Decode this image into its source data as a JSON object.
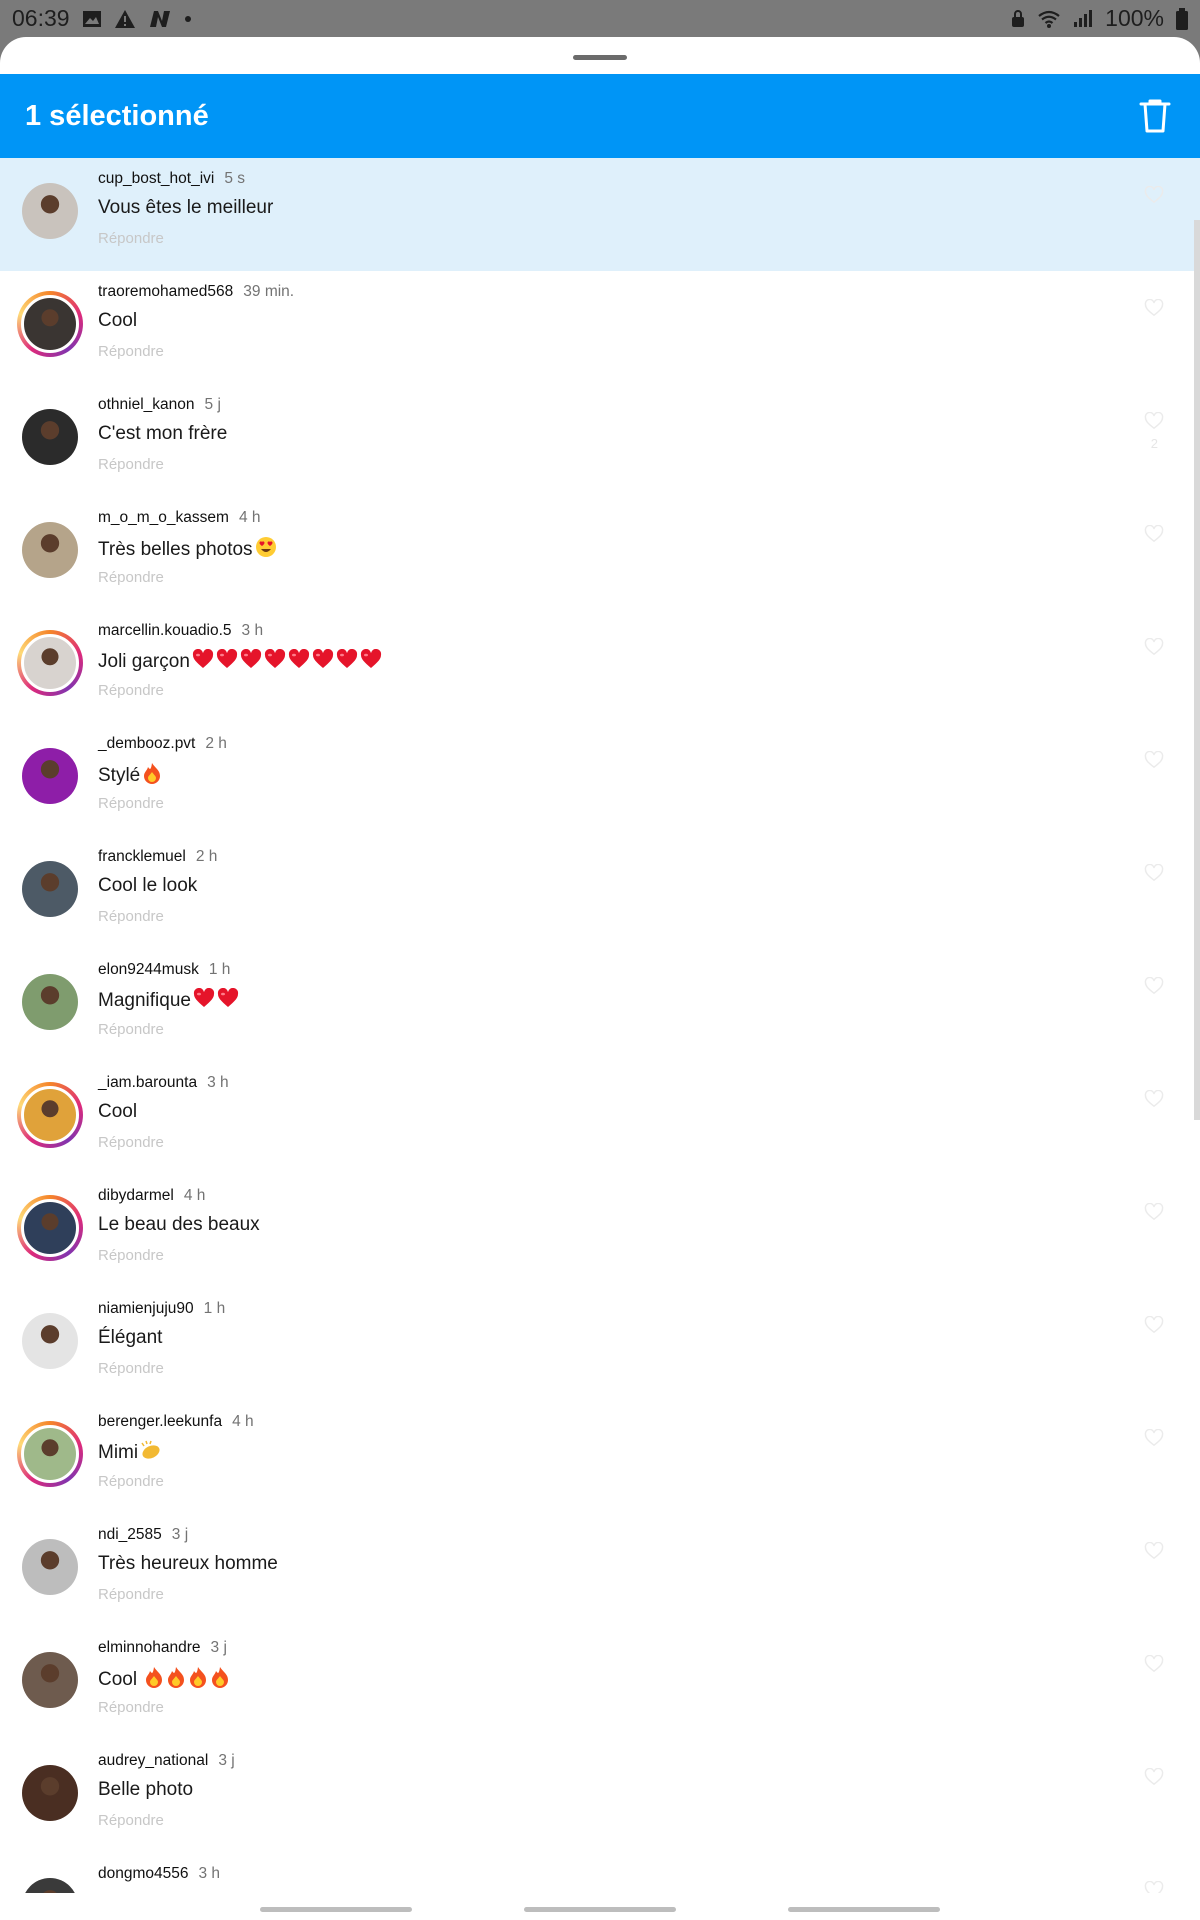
{
  "status_bar": {
    "time": "06:39",
    "battery": "100%",
    "left_icons": [
      "image-icon",
      "alert-icon",
      "n-icon",
      "dot-icon"
    ],
    "right_icons": [
      "lock-icon",
      "wifi-icon",
      "signal-icon",
      "battery-icon"
    ]
  },
  "header": {
    "title": "1 sélectionné",
    "delete_icon": "trash-icon",
    "color": "#0095f6"
  },
  "reply_label": "Répondre",
  "comments": [
    {
      "user": "cup_bost_hot_ivi",
      "time": "5 s",
      "text": "Vous êtes le meilleur",
      "emojis": [],
      "story_ring": false,
      "selected": true,
      "avatar_color": "#c9c3bd"
    },
    {
      "user": "traoremohamed568",
      "time": "39 min.",
      "text": "Cool",
      "emojis": [],
      "story_ring": true,
      "selected": false,
      "avatar_color": "#3a3532"
    },
    {
      "user": "othniel_kanon",
      "time": "5 j",
      "text": "C'est mon frère",
      "emojis": [],
      "story_ring": false,
      "selected": false,
      "avatar_color": "#2b2b2b",
      "likes": "2"
    },
    {
      "user": "m_o_m_o_kassem",
      "time": "4 h",
      "text": "Très belles photos",
      "emojis": [
        "heart-eyes-emoji"
      ],
      "story_ring": false,
      "selected": false,
      "avatar_color": "#b5a48a"
    },
    {
      "user": "marcellin.kouadio.5",
      "time": "3 h",
      "text": "Joli garçon",
      "emojis": [
        "heart-emoji",
        "heart-emoji",
        "heart-emoji",
        "heart-emoji",
        "heart-emoji",
        "heart-emoji",
        "heart-emoji",
        "heart-emoji"
      ],
      "story_ring": true,
      "selected": false,
      "avatar_color": "#d8d3cf"
    },
    {
      "user": "_dembooz.pvt",
      "time": "2 h",
      "text": "Stylé",
      "emojis": [
        "fire-emoji"
      ],
      "story_ring": false,
      "selected": false,
      "avatar_color": "#8e1ea8"
    },
    {
      "user": "francklemuel",
      "time": "2 h",
      "text": "Cool le look",
      "emojis": [],
      "story_ring": false,
      "selected": false,
      "avatar_color": "#4d5a66"
    },
    {
      "user": "elon9244musk",
      "time": "1 h",
      "text": "Magnifique",
      "emojis": [
        "heart-emoji",
        "heart-emoji"
      ],
      "story_ring": false,
      "selected": false,
      "avatar_color": "#7f9c6e"
    },
    {
      "user": "_iam.barounta",
      "time": "3 h",
      "text": "Cool",
      "emojis": [],
      "story_ring": true,
      "selected": false,
      "avatar_color": "#e0a23a"
    },
    {
      "user": "dibydarmel",
      "time": "4 h",
      "text": "Le beau des beaux",
      "emojis": [],
      "story_ring": true,
      "selected": false,
      "avatar_color": "#2f3f5a"
    },
    {
      "user": "niamienjuju90",
      "time": "1 h",
      "text": "Élégant",
      "emojis": [],
      "story_ring": false,
      "selected": false,
      "avatar_color": "#e4e4e4"
    },
    {
      "user": "berenger.leekunfa",
      "time": "4 h",
      "text": "Mimi",
      "emojis": [
        "clap-emoji"
      ],
      "story_ring": true,
      "selected": false,
      "avatar_color": "#9fb98a"
    },
    {
      "user": "ndi_2585",
      "time": "3 j",
      "text": "Très heureux homme",
      "emojis": [],
      "story_ring": false,
      "selected": false,
      "avatar_color": "#bdbdbd"
    },
    {
      "user": "elminnohandre",
      "time": "3 j",
      "text": "Cool ",
      "emojis": [
        "fire-emoji",
        "fire-emoji",
        "fire-emoji",
        "fire-emoji"
      ],
      "story_ring": false,
      "selected": false,
      "avatar_color": "#6e5b4e"
    },
    {
      "user": "audrey_national",
      "time": "3 j",
      "text": "Belle photo",
      "emojis": [],
      "story_ring": false,
      "selected": false,
      "avatar_color": "#4a2e22"
    },
    {
      "user": "dongmo4556",
      "time": "3 h",
      "text": "",
      "emojis": [],
      "story_ring": false,
      "selected": false,
      "avatar_color": "#3a3a3a"
    }
  ]
}
